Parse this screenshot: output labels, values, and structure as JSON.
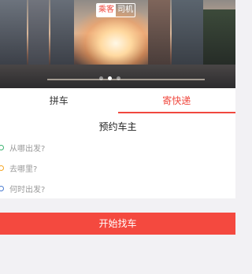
{
  "banner": {
    "mode_toggle": {
      "active_label": "乘客",
      "inactive_label": "司机"
    },
    "carousel": {
      "slide_count": 3,
      "active_index": 1
    }
  },
  "tabs": [
    {
      "label": "拼车",
      "active": false
    },
    {
      "label": "寄快递",
      "active": true
    }
  ],
  "form": {
    "title": "预约车主",
    "fields": [
      {
        "placeholder": "从哪出发?",
        "icon": "origin-dot-icon",
        "color": "#3cb371"
      },
      {
        "placeholder": "去哪里?",
        "icon": "destination-dot-icon",
        "color": "#f5a623"
      },
      {
        "placeholder": "何时出发?",
        "icon": "time-dot-icon",
        "color": "#4a7bd0"
      }
    ]
  },
  "actions": {
    "start_label": "开始找车"
  },
  "colors": {
    "accent": "#f0483e",
    "background": "#f2f1f4"
  }
}
